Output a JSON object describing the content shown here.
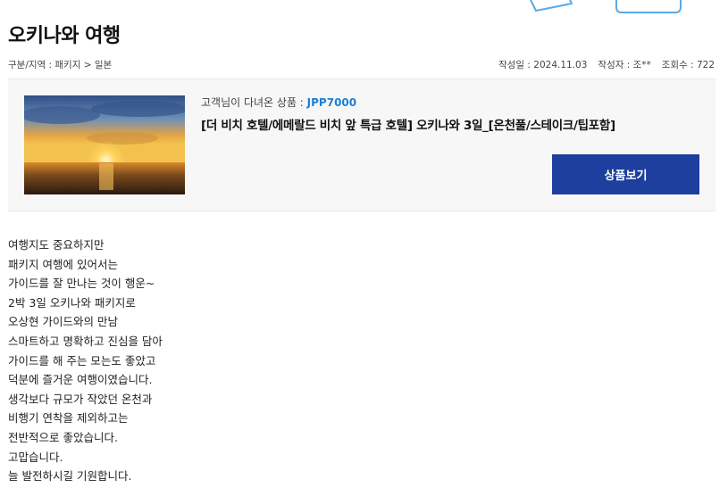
{
  "header": {
    "title": "오키나와 여행",
    "category": "구분/지역 : 패키지 > 일본",
    "date": "작성일 : 2024.11.03",
    "author": "작성자 : 조**",
    "views": "조회수 : 722"
  },
  "product": {
    "label": "고객님이 다녀온 상품 : ",
    "code": "JPP7000",
    "title": "[더 비치 호텔/에메랄드 비치 앞 특급 호텔] 오키나와 3일_[온천풀/스테이크/팁포함]",
    "button_label": "상품보기"
  },
  "body_lines": [
    "여행지도 중요하지만",
    "패키지 여행에 있어서는",
    "가이드를 잘 만나는 것이 행운~",
    "2박 3일 오키나와 패키지로",
    "오상현 가이드와의 만남",
    "스마트하고 명확하고 진심을 담아",
    "가이드를 해 주는 모는도 좋았고",
    "덕분에 즐거운 여행이였습니다.",
    "생각보다 규모가 작았던 온천과",
    "비행기 연착을 제외하고는",
    "전반적으로 좋았습니다.",
    "고맙습니다.",
    "늘 발전하시길 기원합니다."
  ],
  "colors": {
    "accent": "#1f3f9e",
    "code": "#1e7fd6",
    "deco": "#5aa9e6"
  }
}
